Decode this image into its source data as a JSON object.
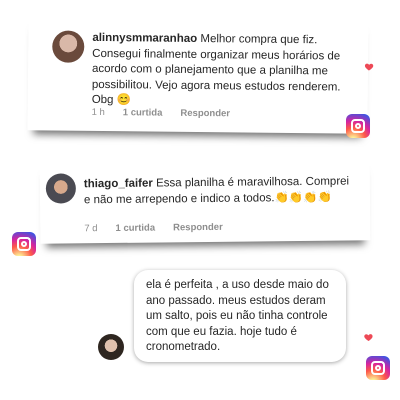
{
  "comment1": {
    "username": "alinnysmmaranhao",
    "text": "Melhor compra que fiz. Consegui finalmente organizar meus horários de acordo com o planejamento que a planilha me possibilitou. Vejo agora meus estudos renderem. Obg 😊",
    "time": "1 h",
    "likes": "1 curtida",
    "reply": "Responder"
  },
  "comment2": {
    "username": "thiago_faifer",
    "text": "Essa planilha é maravilhosa. Comprei e não me arrependo e indico a todos.👏👏👏👏",
    "time": "7 d",
    "likes": "1 curtida",
    "reply": "Responder"
  },
  "message3": {
    "text": "ela é perfeita , a uso desde maio do ano passado. meus estudos deram um salto, pois eu não tinha controle com que eu fazia. hoje tudo é cronometrado."
  },
  "colors": {
    "heart": "#ed4956",
    "meta": "#8e8e8e"
  },
  "icons": [
    "heart-icon",
    "instagram-icon",
    "avatar"
  ]
}
